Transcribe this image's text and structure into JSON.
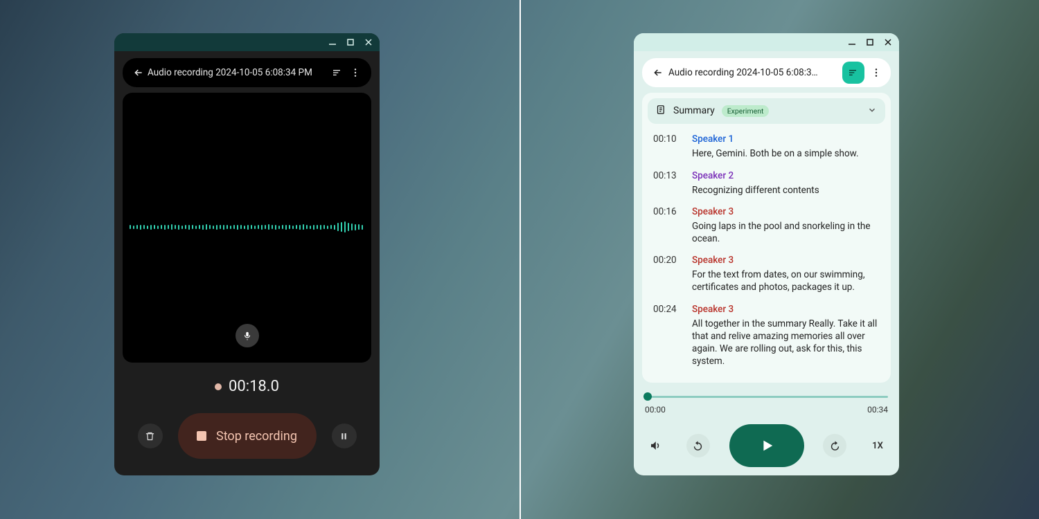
{
  "left": {
    "title": "Audio recording 2024-10-05 6:08:34 PM",
    "timer": "00:18.0",
    "stop_label": "Stop recording"
  },
  "right": {
    "title": "Audio recording 2024-10-05 6:08:3…",
    "summary_label": "Summary",
    "summary_badge": "Experiment",
    "transcript": [
      {
        "time": "00:10",
        "speaker": "Speaker 1",
        "cls": "sp1",
        "text": "Here, Gemini. Both be on a simple show."
      },
      {
        "time": "00:13",
        "speaker": "Speaker 2",
        "cls": "sp2",
        "text": "Recognizing different contents"
      },
      {
        "time": "00:16",
        "speaker": "Speaker 3",
        "cls": "sp3",
        "text": "Going laps in the pool and snorkeling in the ocean."
      },
      {
        "time": "00:20",
        "speaker": "Speaker 3",
        "cls": "sp3",
        "text": "For the text from dates, on our swimming, certificates and photos, packages it up."
      },
      {
        "time": "00:24",
        "speaker": "Speaker 3",
        "cls": "sp3",
        "text": "All together in the summary Really. Take it all that and relive amazing memories all over again. We are rolling out, ask for this, this system."
      }
    ],
    "current_time": "00:00",
    "total_time": "00:34",
    "speed": "1X"
  }
}
